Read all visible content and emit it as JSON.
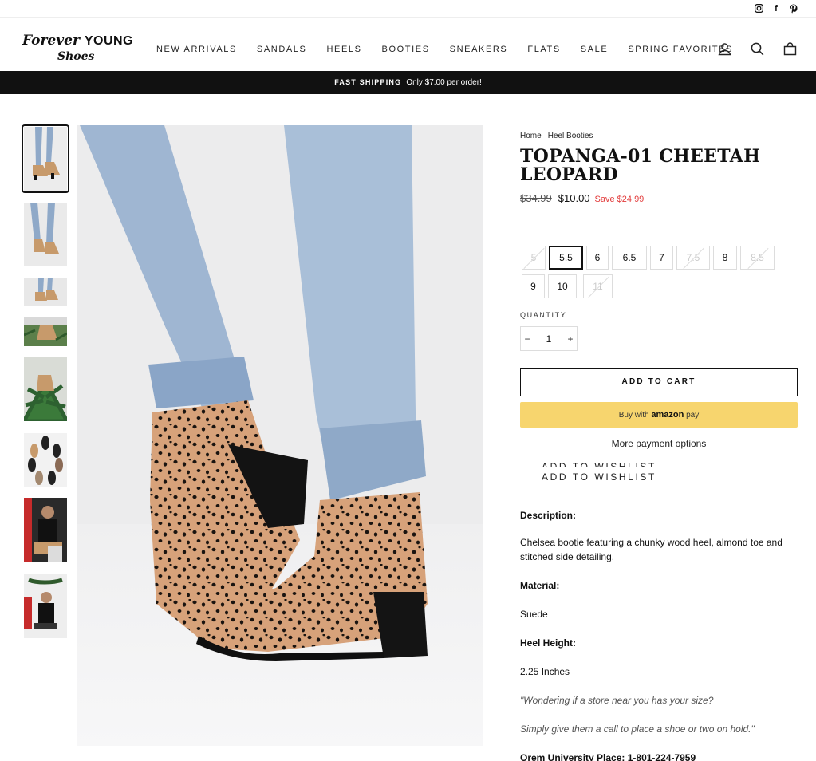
{
  "social": {
    "instagram": "instagram-icon",
    "facebook": "facebook-icon",
    "pinterest": "pinterest-icon"
  },
  "logo": {
    "line1_script": "Forever",
    "line1_bold": "YOUNG",
    "line2": "Shoes"
  },
  "nav": [
    "NEW ARRIVALS",
    "SANDALS",
    "HEELS",
    "BOOTIES",
    "SNEAKERS",
    "FLATS",
    "SALE",
    "SPRING FAVORITES"
  ],
  "header_icons": [
    "user-icon",
    "search-icon",
    "cart-icon"
  ],
  "announcement": {
    "strong": "FAST SHIPPING",
    "text": "Only $7.00 per order!"
  },
  "breadcrumb": {
    "home": "Home",
    "current": "Heel Booties"
  },
  "product": {
    "title": "TOPANGA-01 CHEETAH LEOPARD",
    "price_old": "$34.99",
    "price_new": "$10.00",
    "save": "Save $24.99"
  },
  "sizes": [
    {
      "label": "5",
      "state": "disabled"
    },
    {
      "label": "5.5",
      "state": "selected"
    },
    {
      "label": "6",
      "state": "available"
    },
    {
      "label": "6.5",
      "state": "available"
    },
    {
      "label": "7",
      "state": "available"
    },
    {
      "label": "7.5",
      "state": "disabled"
    },
    {
      "label": "8",
      "state": "available"
    },
    {
      "label": "8.5",
      "state": "disabled"
    },
    {
      "label": "9",
      "state": "available"
    },
    {
      "label": "10",
      "state": "available"
    },
    {
      "label": "11",
      "state": "disabled"
    }
  ],
  "quantity": {
    "label": "QUANTITY",
    "minus": "−",
    "value": "1",
    "plus": "+"
  },
  "buttons": {
    "add_to_cart": "ADD TO CART",
    "amazon_prefix": "Buy with",
    "amazon_brand": "amazon",
    "amazon_suffix": "pay",
    "more_payment": "More payment options",
    "wishlist": "ADD TO WISHLIST"
  },
  "description": {
    "desc_label": "Description:",
    "desc_text": "Chelsea bootie featuring a chunky wood heel, almond toe and stitched side detailing.",
    "material_label": "Material:",
    "material_text": "Suede",
    "heel_label": "Heel Height:",
    "heel_text": "2.25 Inches",
    "quote1": "\"Wondering if a store near you has your size?",
    "quote2": "Simply give them a call to place a shoe or two on hold.\"",
    "store": "Orem University Place: 1-801-224-7959"
  }
}
